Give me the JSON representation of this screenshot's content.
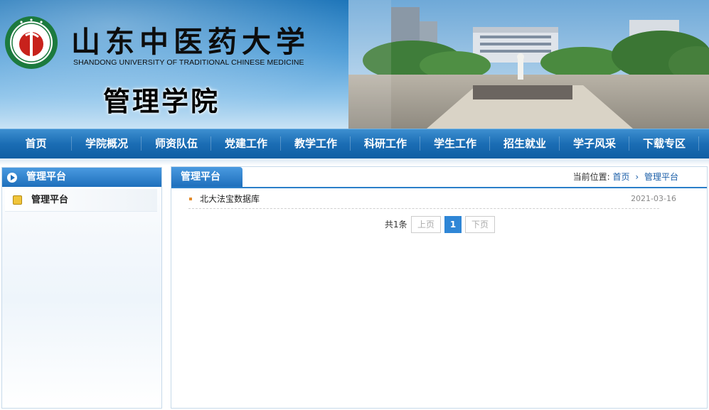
{
  "header": {
    "university_cn": "山东中医药大学",
    "university_en": "SHANDONG UNIVERSITY OF TRADITIONAL CHINESE MEDICINE",
    "school_name": "管理学院",
    "logo_icon": "university-seal-icon"
  },
  "nav": {
    "items": [
      "首页",
      "学院概况",
      "师资队伍",
      "党建工作",
      "教学工作",
      "科研工作",
      "学生工作",
      "招生就业",
      "学子风采",
      "下载专区"
    ]
  },
  "sidebar": {
    "title": "管理平台",
    "items": [
      {
        "label": "管理平台",
        "icon": "folder-bullet-icon"
      }
    ]
  },
  "main": {
    "tab_title": "管理平台",
    "breadcrumb": {
      "prefix": "当前位置:",
      "home": "首页",
      "separator": "›",
      "current": "管理平台"
    },
    "list": [
      {
        "title": "北大法宝数据库",
        "date": "2021-03-16"
      }
    ],
    "pager": {
      "total": "共1条",
      "prev": "上页",
      "current_page": "1",
      "next": "下页"
    }
  },
  "colors": {
    "nav_blue": "#1b6db4",
    "accent": "#2f86d6",
    "bullet_orange": "#e38b2c"
  }
}
